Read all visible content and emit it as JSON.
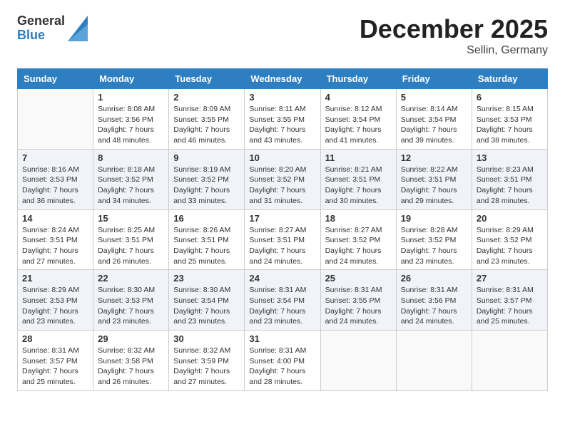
{
  "header": {
    "logo_general": "General",
    "logo_blue": "Blue",
    "month_title": "December 2025",
    "location": "Sellin, Germany"
  },
  "weekdays": [
    "Sunday",
    "Monday",
    "Tuesday",
    "Wednesday",
    "Thursday",
    "Friday",
    "Saturday"
  ],
  "weeks": [
    [
      {
        "day": null,
        "sunrise": null,
        "sunset": null,
        "daylight": null
      },
      {
        "day": "1",
        "sunrise": "Sunrise: 8:08 AM",
        "sunset": "Sunset: 3:56 PM",
        "daylight": "Daylight: 7 hours and 48 minutes."
      },
      {
        "day": "2",
        "sunrise": "Sunrise: 8:09 AM",
        "sunset": "Sunset: 3:55 PM",
        "daylight": "Daylight: 7 hours and 46 minutes."
      },
      {
        "day": "3",
        "sunrise": "Sunrise: 8:11 AM",
        "sunset": "Sunset: 3:55 PM",
        "daylight": "Daylight: 7 hours and 43 minutes."
      },
      {
        "day": "4",
        "sunrise": "Sunrise: 8:12 AM",
        "sunset": "Sunset: 3:54 PM",
        "daylight": "Daylight: 7 hours and 41 minutes."
      },
      {
        "day": "5",
        "sunrise": "Sunrise: 8:14 AM",
        "sunset": "Sunset: 3:54 PM",
        "daylight": "Daylight: 7 hours and 39 minutes."
      },
      {
        "day": "6",
        "sunrise": "Sunrise: 8:15 AM",
        "sunset": "Sunset: 3:53 PM",
        "daylight": "Daylight: 7 hours and 38 minutes."
      }
    ],
    [
      {
        "day": "7",
        "sunrise": "Sunrise: 8:16 AM",
        "sunset": "Sunset: 3:53 PM",
        "daylight": "Daylight: 7 hours and 36 minutes."
      },
      {
        "day": "8",
        "sunrise": "Sunrise: 8:18 AM",
        "sunset": "Sunset: 3:52 PM",
        "daylight": "Daylight: 7 hours and 34 minutes."
      },
      {
        "day": "9",
        "sunrise": "Sunrise: 8:19 AM",
        "sunset": "Sunset: 3:52 PM",
        "daylight": "Daylight: 7 hours and 33 minutes."
      },
      {
        "day": "10",
        "sunrise": "Sunrise: 8:20 AM",
        "sunset": "Sunset: 3:52 PM",
        "daylight": "Daylight: 7 hours and 31 minutes."
      },
      {
        "day": "11",
        "sunrise": "Sunrise: 8:21 AM",
        "sunset": "Sunset: 3:51 PM",
        "daylight": "Daylight: 7 hours and 30 minutes."
      },
      {
        "day": "12",
        "sunrise": "Sunrise: 8:22 AM",
        "sunset": "Sunset: 3:51 PM",
        "daylight": "Daylight: 7 hours and 29 minutes."
      },
      {
        "day": "13",
        "sunrise": "Sunrise: 8:23 AM",
        "sunset": "Sunset: 3:51 PM",
        "daylight": "Daylight: 7 hours and 28 minutes."
      }
    ],
    [
      {
        "day": "14",
        "sunrise": "Sunrise: 8:24 AM",
        "sunset": "Sunset: 3:51 PM",
        "daylight": "Daylight: 7 hours and 27 minutes."
      },
      {
        "day": "15",
        "sunrise": "Sunrise: 8:25 AM",
        "sunset": "Sunset: 3:51 PM",
        "daylight": "Daylight: 7 hours and 26 minutes."
      },
      {
        "day": "16",
        "sunrise": "Sunrise: 8:26 AM",
        "sunset": "Sunset: 3:51 PM",
        "daylight": "Daylight: 7 hours and 25 minutes."
      },
      {
        "day": "17",
        "sunrise": "Sunrise: 8:27 AM",
        "sunset": "Sunset: 3:51 PM",
        "daylight": "Daylight: 7 hours and 24 minutes."
      },
      {
        "day": "18",
        "sunrise": "Sunrise: 8:27 AM",
        "sunset": "Sunset: 3:52 PM",
        "daylight": "Daylight: 7 hours and 24 minutes."
      },
      {
        "day": "19",
        "sunrise": "Sunrise: 8:28 AM",
        "sunset": "Sunset: 3:52 PM",
        "daylight": "Daylight: 7 hours and 23 minutes."
      },
      {
        "day": "20",
        "sunrise": "Sunrise: 8:29 AM",
        "sunset": "Sunset: 3:52 PM",
        "daylight": "Daylight: 7 hours and 23 minutes."
      }
    ],
    [
      {
        "day": "21",
        "sunrise": "Sunrise: 8:29 AM",
        "sunset": "Sunset: 3:53 PM",
        "daylight": "Daylight: 7 hours and 23 minutes."
      },
      {
        "day": "22",
        "sunrise": "Sunrise: 8:30 AM",
        "sunset": "Sunset: 3:53 PM",
        "daylight": "Daylight: 7 hours and 23 minutes."
      },
      {
        "day": "23",
        "sunrise": "Sunrise: 8:30 AM",
        "sunset": "Sunset: 3:54 PM",
        "daylight": "Daylight: 7 hours and 23 minutes."
      },
      {
        "day": "24",
        "sunrise": "Sunrise: 8:31 AM",
        "sunset": "Sunset: 3:54 PM",
        "daylight": "Daylight: 7 hours and 23 minutes."
      },
      {
        "day": "25",
        "sunrise": "Sunrise: 8:31 AM",
        "sunset": "Sunset: 3:55 PM",
        "daylight": "Daylight: 7 hours and 24 minutes."
      },
      {
        "day": "26",
        "sunrise": "Sunrise: 8:31 AM",
        "sunset": "Sunset: 3:56 PM",
        "daylight": "Daylight: 7 hours and 24 minutes."
      },
      {
        "day": "27",
        "sunrise": "Sunrise: 8:31 AM",
        "sunset": "Sunset: 3:57 PM",
        "daylight": "Daylight: 7 hours and 25 minutes."
      }
    ],
    [
      {
        "day": "28",
        "sunrise": "Sunrise: 8:31 AM",
        "sunset": "Sunset: 3:57 PM",
        "daylight": "Daylight: 7 hours and 25 minutes."
      },
      {
        "day": "29",
        "sunrise": "Sunrise: 8:32 AM",
        "sunset": "Sunset: 3:58 PM",
        "daylight": "Daylight: 7 hours and 26 minutes."
      },
      {
        "day": "30",
        "sunrise": "Sunrise: 8:32 AM",
        "sunset": "Sunset: 3:59 PM",
        "daylight": "Daylight: 7 hours and 27 minutes."
      },
      {
        "day": "31",
        "sunrise": "Sunrise: 8:31 AM",
        "sunset": "Sunset: 4:00 PM",
        "daylight": "Daylight: 7 hours and 28 minutes."
      },
      {
        "day": null,
        "sunrise": null,
        "sunset": null,
        "daylight": null
      },
      {
        "day": null,
        "sunrise": null,
        "sunset": null,
        "daylight": null
      },
      {
        "day": null,
        "sunrise": null,
        "sunset": null,
        "daylight": null
      }
    ]
  ]
}
